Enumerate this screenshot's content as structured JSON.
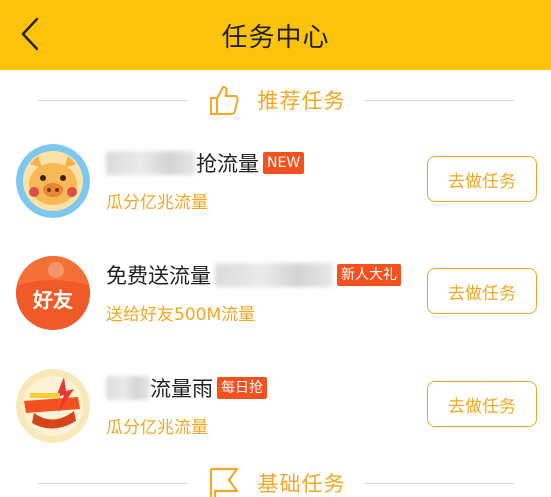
{
  "header": {
    "title": "任务中心",
    "back_icon": "chevron-left-icon"
  },
  "recommended_section": {
    "label": "推荐任务",
    "icon": "thumbs-up-icon"
  },
  "tasks": [
    {
      "name_suffix": "抢流量",
      "badge": "NEW",
      "subtitle": "瓜分亿兆流量",
      "button": "去做任务",
      "avatar": "pig-avatar"
    },
    {
      "name_prefix": "免费送流量",
      "badge": "新人大礼",
      "subtitle": "送给好友500M流量",
      "button": "去做任务",
      "avatar": "friend-avatar",
      "avatar_text": "好友"
    },
    {
      "name_suffix": "流量雨",
      "badge": "每日抢",
      "subtitle": "瓜分亿兆流量",
      "button": "去做任务",
      "avatar": "rain-avatar"
    }
  ],
  "basic_section": {
    "label": "基础任务",
    "icon": "flag-icon"
  },
  "colors": {
    "header_bg": "#fdc30a",
    "accent": "#f5a623",
    "badge": "#f4511e"
  }
}
